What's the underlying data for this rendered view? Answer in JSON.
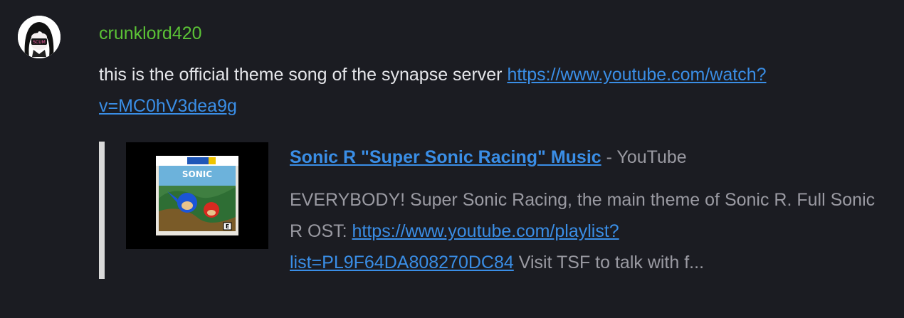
{
  "message": {
    "username": "crunklord420",
    "avatar_badge": "SCUM",
    "text": "this is the official theme song of the synapse server ",
    "link_line1": "https://www.youtube.com/watch?",
    "link_line2": "v=MC0hV3dea9g"
  },
  "embed": {
    "title_link": "Sonic R \"Super Sonic Racing\" Music",
    "site_suffix": " - YouTube",
    "thumbnail_icon": "sonic-r-box-art",
    "description_prefix": "EVERYBODY! Super Sonic Racing, the main theme of Sonic R. Full Sonic R OST: ",
    "description_link_line1": "https://www.youtube.com/playlist?",
    "description_link_line2": "list=PL9F64DA808270DC84",
    "description_suffix": " Visit TSF to talk with f..."
  },
  "colors": {
    "background": "#1b1c22",
    "username": "#5bc236",
    "link": "#3a8ee6",
    "body_text": "#e5e6ea",
    "muted_text": "#9a9aa2",
    "embed_bar": "#d9d9d9"
  }
}
